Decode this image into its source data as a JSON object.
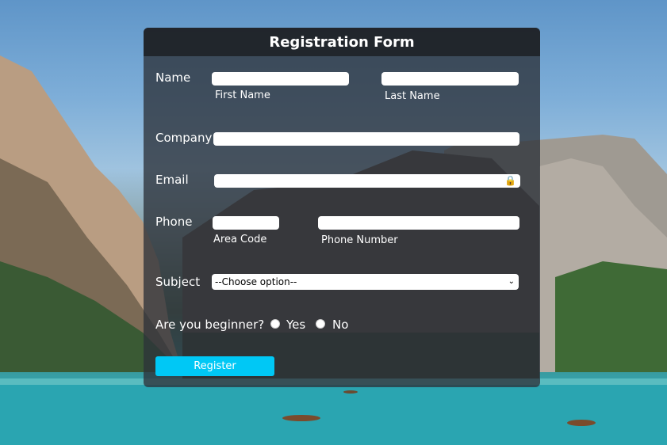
{
  "form": {
    "title": "Registration Form",
    "name_label": "Name",
    "first_name_hint": "First Name",
    "last_name_hint": "Last Name",
    "company_label": "Company",
    "email_label": "Email",
    "phone_label": "Phone",
    "area_code_hint": "Area Code",
    "phone_number_hint": "Phone Number",
    "subject_label": "Subject",
    "subject_selected": "--Choose option--",
    "beginner_label": "Are you beginner?",
    "yes_label": "Yes",
    "no_label": "No",
    "register_label": "Register",
    "lock_icon": "🔒",
    "chevron_icon": "⌄"
  },
  "colors": {
    "form_bg": "#2d323a",
    "header_bg": "#1f2328",
    "button": "#00c8f5",
    "lock": "#d9192a"
  }
}
